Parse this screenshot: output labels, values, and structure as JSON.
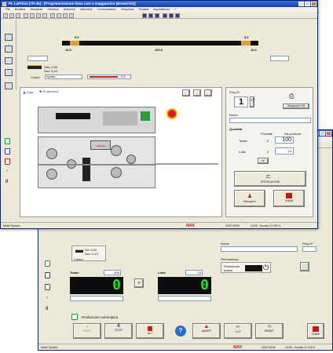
{
  "front": {
    "title": "PL LaPrima (TR 40) - [Programmazione linea cavi a maggazzino (Bread.lit2)]",
    "menu": [
      "File",
      "Modifica",
      "Visualizza",
      "Gestione",
      "Strumenti",
      "Macchina",
      "Comunicazione",
      "Sequenza",
      "Finestra",
      "Impostazioni",
      "?"
    ],
    "scale": {
      "left_top": "5.0",
      "right_top": "5.0",
      "left_bottom": "10.0",
      "center_bottom": "100.0",
      "right_bottom": "10.0"
    },
    "info": {
      "line1": "Strk: 0.00",
      "line2": "Sec: 0.13",
      "colore_label": "Colore",
      "colore_value": "isolato",
      "cable_value": "0.8"
    },
    "tabs": {
      "tab1": "Lista",
      "tab2": "Produzione"
    },
    "machine_brand": "LaPrima",
    "right": {
      "prog_label": "Prog N°",
      "prog_value": "1",
      "sequence_button": "Sequenze ON",
      "nome_label": "Nome",
      "quantita_label": "Quantità",
      "prodotte_label": "Prodotte",
      "da_produrre_label": "Da produrre",
      "totale_label": "Totale",
      "totale_produced": "0",
      "totale_target": "100",
      "lotto_label": "Lotto",
      "lotto_produced": "0",
      "lotto_target": "10",
      "ok_button": "W",
      "produzione_button": "PRODUZIONE",
      "recupero_label": "Recupero",
      "chiudi_label": "Chiudi"
    },
    "status": {
      "left": "MatiX System",
      "date": "20/07/2006",
      "time": "10:53 - Sucialo 01 000 S",
      "brand": "MAK"
    }
  },
  "back": {
    "info": {
      "line1": "Str: 0.00",
      "line2": "Sec: 0.13",
      "colore_label": "Colore"
    },
    "nome_label": "Nome",
    "prog_label": "Prog N°",
    "permanenza_label": "Permanenza",
    "produzione_label": "Produzione",
    "tranne_label": "tranne",
    "totale": {
      "label": "Totale",
      "value": "100",
      "display": "0"
    },
    "lotto": {
      "label": "Lotto",
      "value": "10",
      "display": "0"
    },
    "auto_label": "Produzione Automatica",
    "buttons": [
      "START",
      "STOP",
      "ALT",
      "?",
      "ABORT",
      "CUT",
      "RESET"
    ],
    "chiudi_label": "Chiudi",
    "status": {
      "left": "MatiX System",
      "date": "20/07/2006",
      "time": "10:59 - Sucialo 01 000 S",
      "brand": "MAK"
    }
  },
  "colors": {
    "titlebar": "#0a3fb0",
    "lcd_digits": "#22e030",
    "brand_red": "#d21a1a",
    "accent_orange": "#e0a030"
  }
}
